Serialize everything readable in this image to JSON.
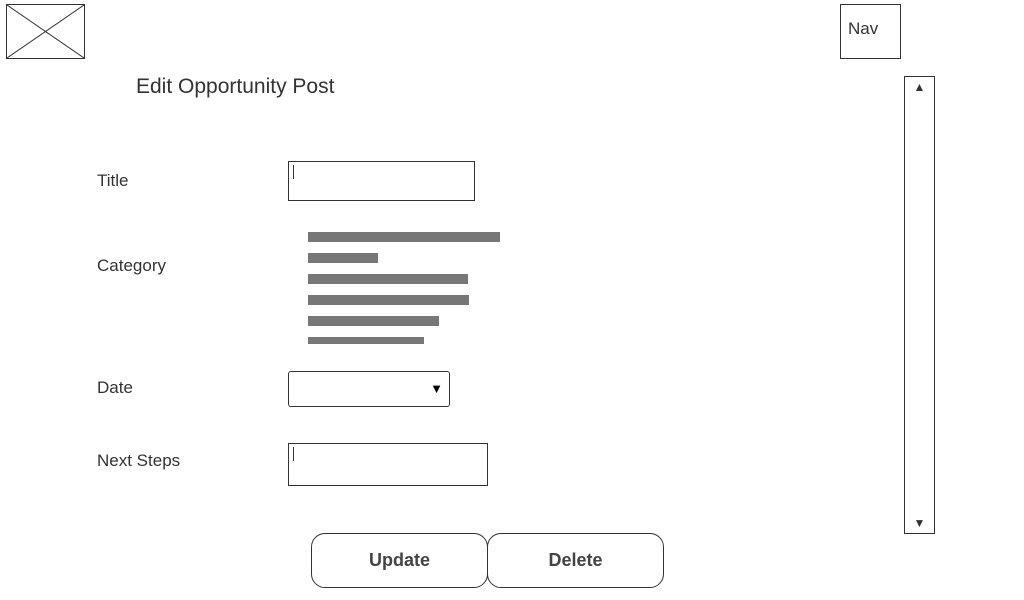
{
  "header": {
    "logo_icon": "image-placeholder-icon",
    "nav_label": "Nav"
  },
  "page": {
    "title": "Edit Opportunity Post"
  },
  "form": {
    "title": {
      "label": "Title",
      "value": ""
    },
    "category": {
      "label": "Category"
    },
    "date": {
      "label": "Date",
      "value": "",
      "arrow_icon": "caret-down-icon"
    },
    "next_steps": {
      "label": "Next Steps",
      "value": ""
    }
  },
  "actions": {
    "update_label": "Update",
    "delete_label": "Delete"
  },
  "scrollbar": {
    "up_icon": "scroll-up-icon",
    "down_icon": "scroll-down-icon"
  },
  "colors": {
    "border": "#333333",
    "text": "#333333",
    "placeholder_text": "#777777",
    "background": "#ffffff"
  }
}
